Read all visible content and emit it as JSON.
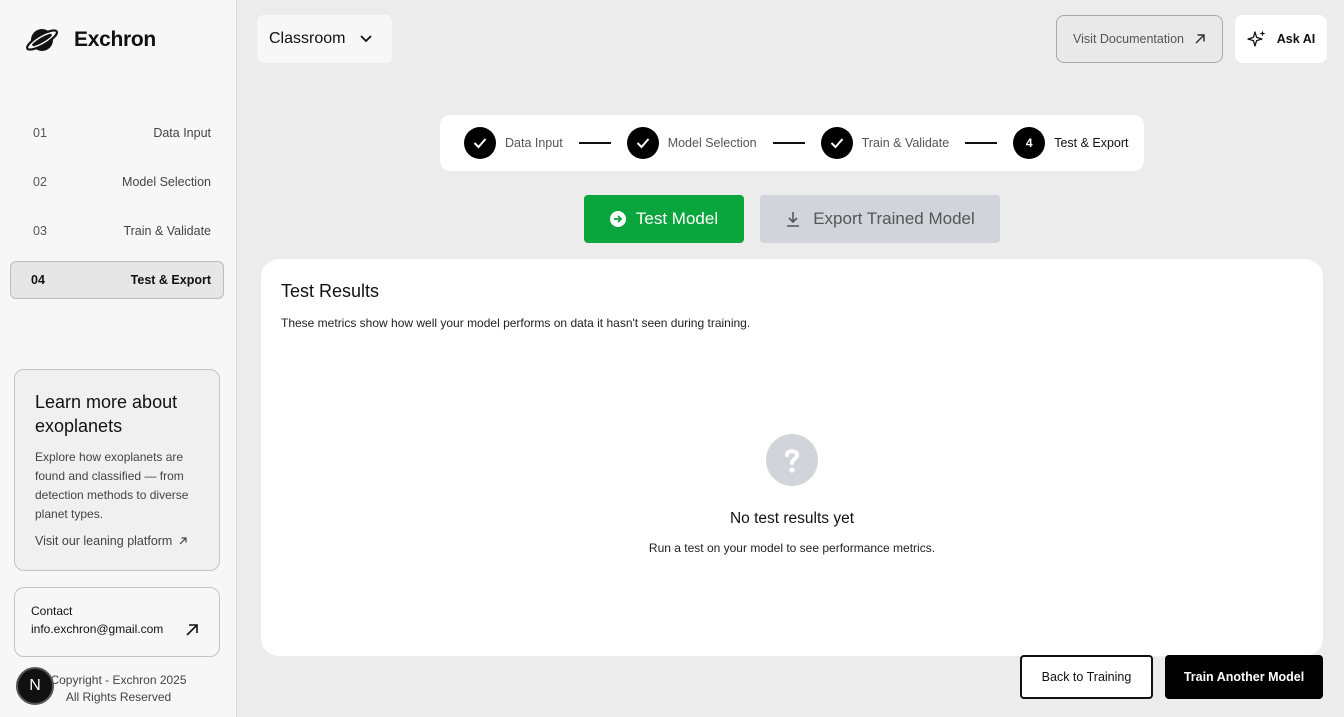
{
  "brand": {
    "name": "Exchron",
    "logo_icon": "planet-icon"
  },
  "sidebar": {
    "items": [
      {
        "num": "01",
        "label": "Data Input",
        "active": false
      },
      {
        "num": "02",
        "label": "Model Selection",
        "active": false
      },
      {
        "num": "03",
        "label": "Train & Validate",
        "active": false
      },
      {
        "num": "04",
        "label": "Test & Export",
        "active": true
      }
    ],
    "learn": {
      "title": "Learn more about exoplanets",
      "text": "Explore how exoplanets are found and classified — from detection methods to diverse planet types.",
      "link": "Visit our leaning platform"
    },
    "contact": {
      "label": "Contact",
      "email": "info.exchron@gmail.com"
    },
    "copyright_line1": "Copyright - Exchron 2025",
    "copyright_line2": "All Rights Reserved",
    "badge": "N"
  },
  "header": {
    "mode_select": "Classroom",
    "doc_button": "Visit Documentation",
    "ask_button": "Ask AI"
  },
  "stepper": {
    "steps": [
      {
        "label": "Data Input",
        "state": "done"
      },
      {
        "label": "Model Selection",
        "state": "done"
      },
      {
        "label": "Train & Validate",
        "state": "done"
      },
      {
        "label": "Test & Export",
        "state": "current",
        "number": "4"
      }
    ]
  },
  "actions": {
    "test_button": "Test Model",
    "export_button": "Export Trained Model"
  },
  "results": {
    "title": "Test Results",
    "description": "These metrics show how well your model performs on data it hasn't seen during training.",
    "empty_title": "No test results yet",
    "empty_text": "Run a test on your model to see performance metrics."
  },
  "footer": {
    "back_button": "Back to Training",
    "another_button": "Train Another Model"
  },
  "colors": {
    "accent_green": "#0aa53c",
    "disabled_gray": "#d1d5db",
    "background": "#ececec",
    "sidebar_bg": "#f7f7f7"
  }
}
